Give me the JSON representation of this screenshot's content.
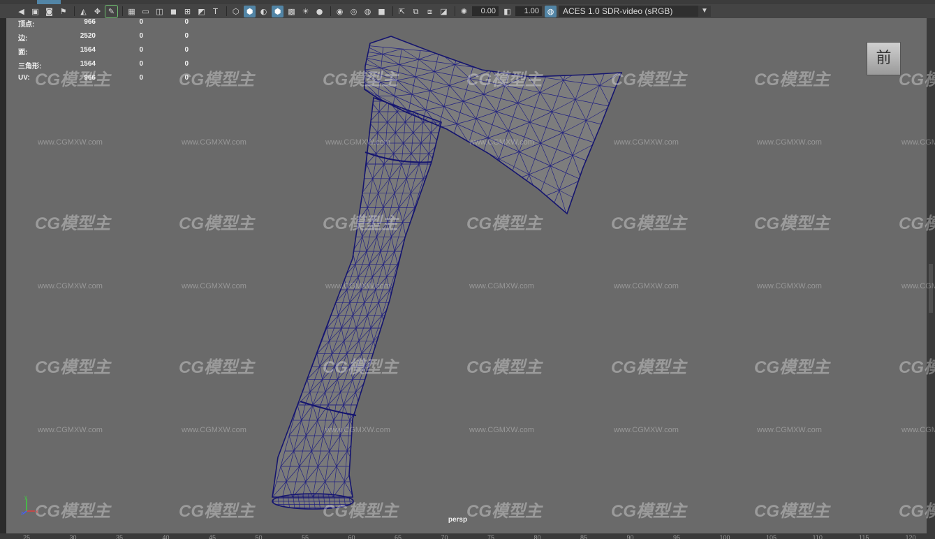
{
  "toolbar": {
    "icons": [
      "camera-icon",
      "camera-attributes-icon",
      "bookmark-icon",
      "image-plane-icon",
      "grease-pencil-icon",
      "2d-pan-zoom-icon",
      "grid-icon",
      "film-gate-icon",
      "resolution-gate-icon",
      "gate-mask-icon",
      "field-chart-icon",
      "safe-action-icon",
      "safe-title-icon",
      "wireframe-icon",
      "smooth-shade-icon",
      "shade-wireframe-icon",
      "default-material-icon",
      "xray-icon",
      "textured-icon",
      "lights-icon",
      "shadows-icon",
      "ambient-occlusion-icon",
      "motion-blur-icon",
      "antialiasing-icon",
      "depth-of-field-icon",
      "isolate-select-icon",
      "xray-joints-icon",
      "xray-active-icon",
      "backface-culling-icon",
      "exposure-icon",
      "gamma-icon",
      "color-management-icon"
    ],
    "exposure_value": "0.00",
    "gamma_value": "1.00",
    "color_management": "ACES 1.0 SDR-video (sRGB)"
  },
  "hud": {
    "rows": [
      {
        "label": "顶点:",
        "c1": "966",
        "c2": "0",
        "c3": "0"
      },
      {
        "label": "边:",
        "c1": "2520",
        "c2": "0",
        "c3": "0"
      },
      {
        "label": "面:",
        "c1": "1564",
        "c2": "0",
        "c3": "0"
      },
      {
        "label": "三角形:",
        "c1": "1564",
        "c2": "0",
        "c3": "0"
      },
      {
        "label": "UV:",
        "c1": "966",
        "c2": "0",
        "c3": "0"
      }
    ]
  },
  "view_cube": {
    "face": "前"
  },
  "camera_label": "persp",
  "axis": {
    "x": "x",
    "y": "y",
    "z": "z"
  },
  "ruler_ticks": [
    "25",
    "30",
    "35",
    "40",
    "45",
    "50",
    "55",
    "60",
    "65",
    "70",
    "75",
    "80",
    "85",
    "90",
    "95",
    "100",
    "105",
    "110",
    "115",
    "120"
  ],
  "watermark": {
    "logo": "CG模型主",
    "url": "www.CGMXW.com"
  },
  "colors": {
    "viewport_bg": "#6a6a6a",
    "mesh_fill": "#7b7b7b",
    "wireframe": "#1a1a7a",
    "active_button": "#5285a6"
  }
}
